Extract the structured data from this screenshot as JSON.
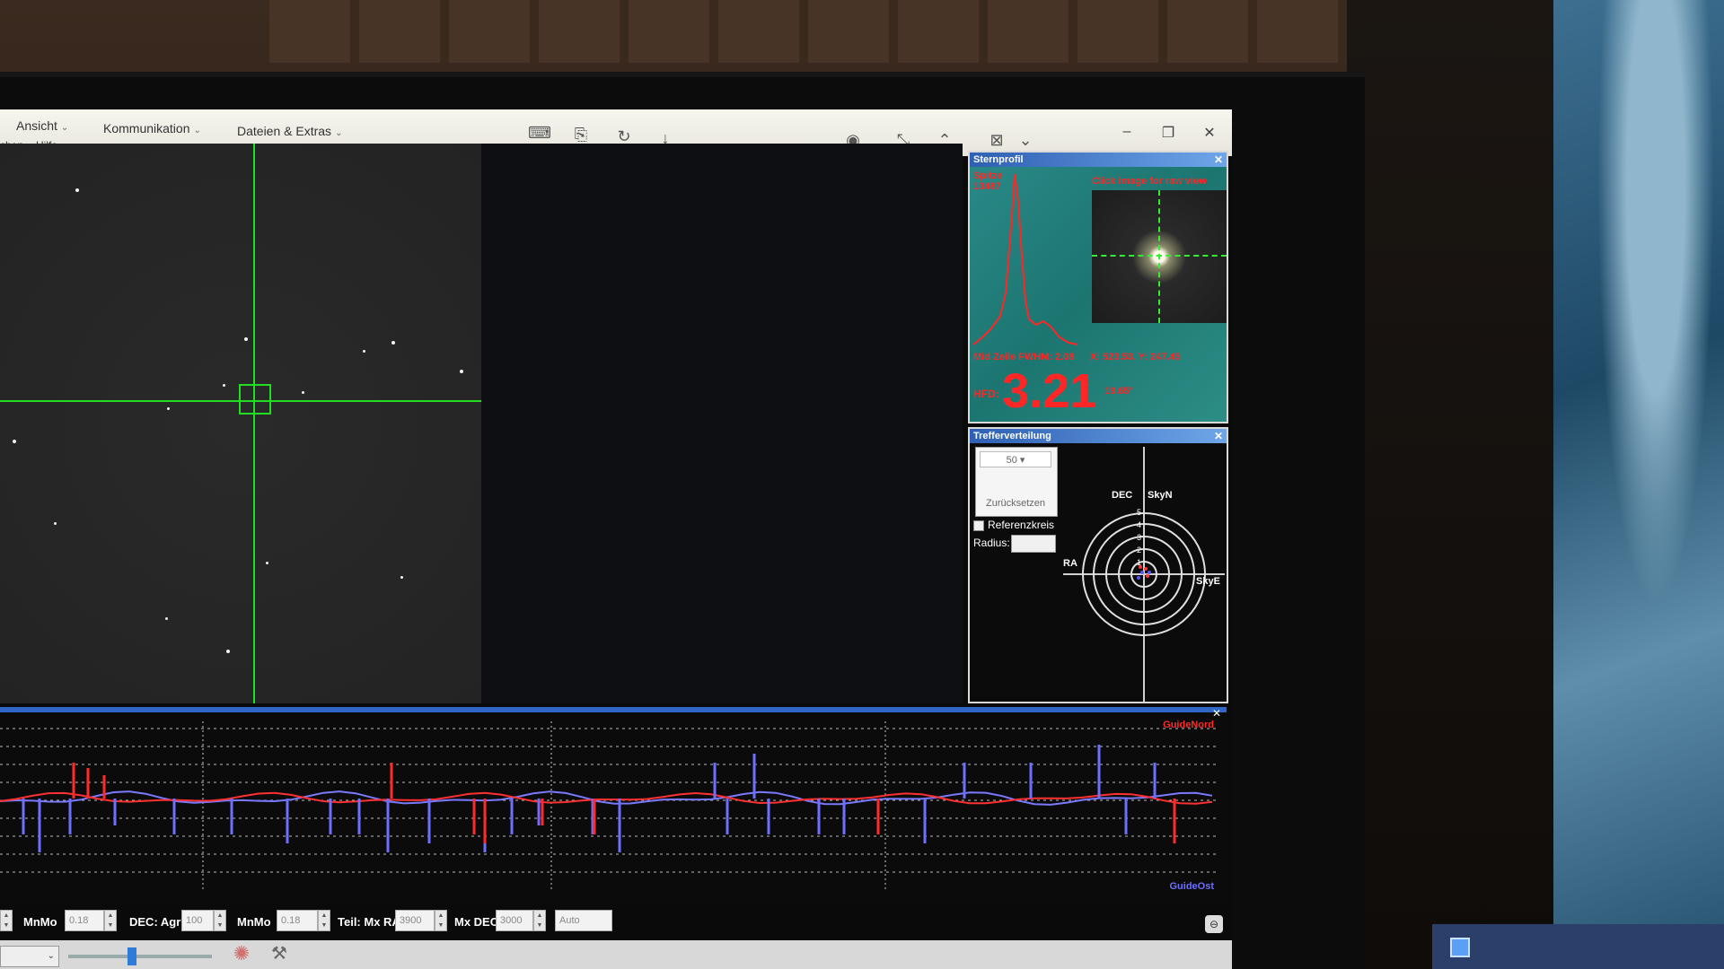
{
  "menu": {
    "view": "Ansicht",
    "communication": "Kommunikation",
    "files_extras": "Dateien & Extras",
    "search_fragment": "chen",
    "help": "Hilfe"
  },
  "star_profile": {
    "title": "Sternprofil",
    "peak_label": "Spitze",
    "peak_value": "13487",
    "click_hint": "Click image for raw view",
    "fwhm": "Mid Zeile FWHM: 2.08",
    "coords": "X: 523.53, Y: 247.45",
    "hfd_label": "HFD:",
    "hfd_value": "3.21",
    "arcsec": "19.65\""
  },
  "distribution": {
    "title": "Trefferverteilung",
    "count": "50",
    "reset": "Zurücksetzen",
    "ref_circle": "Referenzkreis",
    "radius": "Radius:",
    "axis_dec": "DEC",
    "axis_skyn": "SkyN",
    "axis_ra": "RA",
    "axis_skye": "SkyE",
    "rings": [
      "5",
      "4",
      "3",
      "2",
      "1"
    ]
  },
  "graph": {
    "legend_north": "GuideNord",
    "legend_east": "GuideOst"
  },
  "controls": {
    "mnmo_label": "MnMo",
    "mnmo_value": "0.18",
    "dec_agr_label": "DEC: Agr",
    "dec_agr_value": "100",
    "mnmo2_label": "MnMo",
    "mnmo2_value": "0.18",
    "mx_ra_label": "Teil: Mx RA",
    "mx_ra_value": "3900",
    "mx_dec_label": "Mx DEC",
    "mx_dec_value": "3000",
    "mode_value": "Auto"
  }
}
